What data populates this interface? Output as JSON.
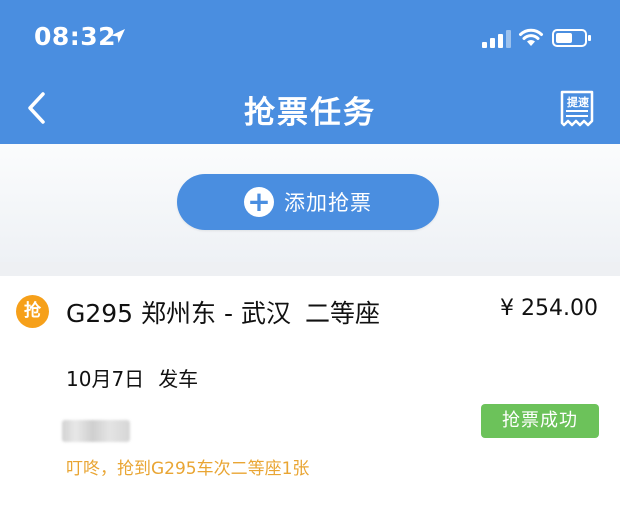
{
  "status_bar": {
    "time": "08:32"
  },
  "nav": {
    "title": "抢票任务",
    "receipt_label": "提速"
  },
  "add_ticket": {
    "label": "添加抢票",
    "plus_symbol": "+"
  },
  "task": {
    "badge": "抢",
    "train_route": "G295 郑州东 - 武汉",
    "seat_class": "二等座",
    "price": "¥ 254.00",
    "date": "10月7日",
    "departure_label": "发车",
    "status": "抢票成功",
    "notice": "叮咚，抢到G295车次二等座1张"
  },
  "colors": {
    "primary_blue": "#4a8ee0",
    "success_green": "#6cc25a",
    "badge_orange": "#f6a01a",
    "notice_orange": "#e9a533"
  },
  "icons": {
    "back": "chevron-left-icon",
    "location": "location-arrow-icon",
    "signal": "cellular-signal-icon",
    "wifi": "wifi-icon",
    "battery": "battery-icon",
    "receipt": "receipt-icon",
    "add": "plus-circle-icon"
  }
}
